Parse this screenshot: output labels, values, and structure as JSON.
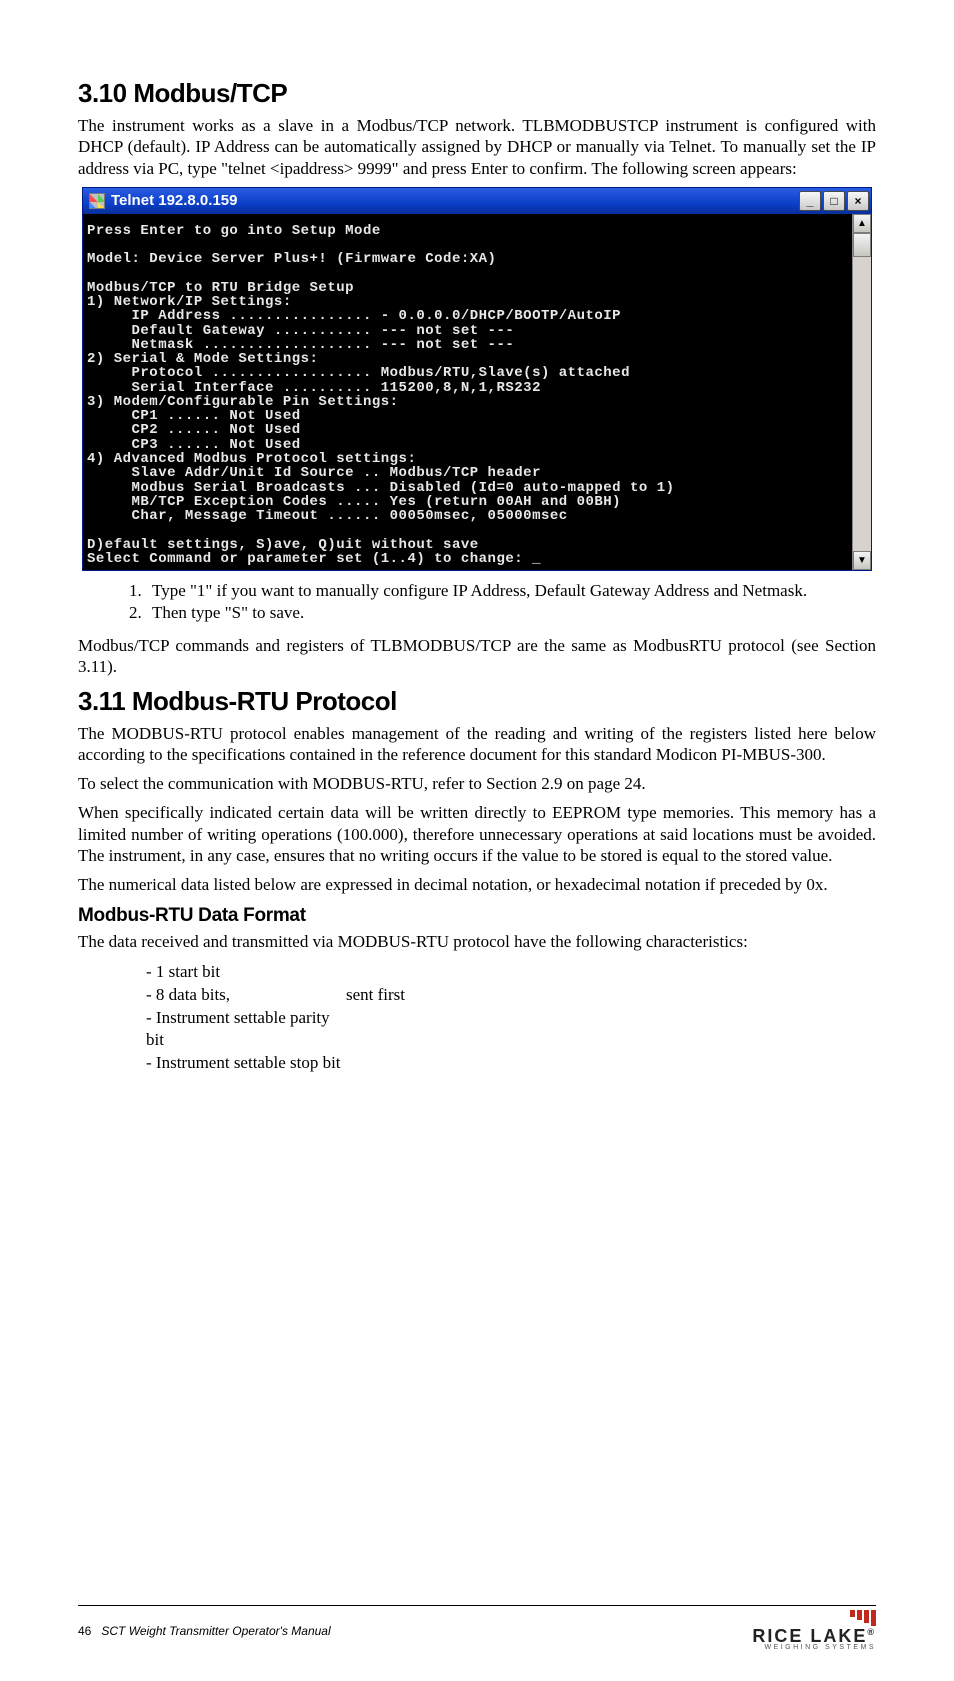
{
  "section310": {
    "heading": "3.10 Modbus/TCP",
    "intro": "The instrument works as a slave in a Modbus/TCP network. TLBMODBUSTCP instrument is configured with DHCP (default). IP Address can be automatically assigned by DHCP or manually via Telnet. To manually set the IP address via PC, type \"telnet <ipaddress> 9999\" and press Enter to confirm. The following screen appears:",
    "steps": [
      "Type \"1\" if you want to manually configure IP Address, Default Gateway Address and Netmask.",
      "Then type \"S\" to save."
    ],
    "closing": "Modbus/TCP commands and registers of TLBMODBUS/TCP are the same as ModbusRTU protocol (see Section 3.11)."
  },
  "telnet": {
    "title": "Telnet 192.8.0.159",
    "content": "Press Enter to go into Setup Mode\n\nModel: Device Server Plus+! (Firmware Code:XA)\n\nModbus/TCP to RTU Bridge Setup\n1) Network/IP Settings:\n     IP Address ................ - 0.0.0.0/DHCP/BOOTP/AutoIP\n     Default Gateway ........... --- not set ---\n     Netmask ................... --- not set ---\n2) Serial & Mode Settings:\n     Protocol .................. Modbus/RTU,Slave(s) attached\n     Serial Interface .......... 115200,8,N,1,RS232\n3) Modem/Configurable Pin Settings:\n     CP1 ...... Not Used\n     CP2 ...... Not Used\n     CP3 ...... Not Used\n4) Advanced Modbus Protocol settings:\n     Slave Addr/Unit Id Source .. Modbus/TCP header\n     Modbus Serial Broadcasts ... Disabled (Id=0 auto-mapped to 1)\n     MB/TCP Exception Codes ..... Yes (return 00AH and 00BH)\n     Char, Message Timeout ...... 00050msec, 05000msec\n\nD)efault settings, S)ave, Q)uit without save\nSelect Command or parameter set (1..4) to change: _"
  },
  "section311": {
    "heading": "3.11 Modbus-RTU Protocol",
    "p1": "The MODBUS-RTU protocol enables management of the reading and writing of the registers listed here below according to the specifications contained in the reference document for this standard Modicon PI-MBUS-300.",
    "p2": "To select the communication with MODBUS-RTU, refer to Section 2.9 on page 24.",
    "p3": "When specifically indicated certain data will be written directly to EEPROM type memories. This memory has a limited number of writing operations (100.000), therefore unnecessary operations at said locations must be avoided. The instrument, in any case, ensures that no writing occurs if the value to be stored is equal to the stored value.",
    "p4": "The numerical data listed below are expressed in decimal notation, or hexadecimal notation if preceded by 0x.",
    "subheading": "Modbus-RTU Data Format",
    "p5": "The data received and transmitted via MODBUS-RTU protocol have the following characteristics:",
    "bullets": [
      [
        "- 1 start bit",
        ""
      ],
      [
        "- 8 data bits,",
        "sent first"
      ],
      [
        "- Instrument settable parity bit",
        ""
      ],
      [
        "- Instrument settable stop bit",
        ""
      ]
    ]
  },
  "footer": {
    "page": "46",
    "doc": "SCT Weight Transmitter  Operator's Manual",
    "brand": "RICE LAKE",
    "brandsub": "WEIGHING SYSTEMS"
  },
  "winbuttons": {
    "min": "_",
    "max": "□",
    "close": "×"
  },
  "scroll": {
    "up": "▲",
    "down": "▼"
  }
}
